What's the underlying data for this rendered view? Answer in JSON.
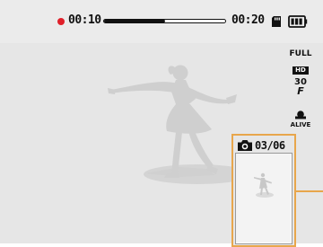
{
  "recording": {
    "current_time": "00:10",
    "total_time": "00:20",
    "progress_fraction": 0.5,
    "rec_indicator_color": "#e0202a"
  },
  "status_icons": [
    "memory-card-icon",
    "battery-icon"
  ],
  "side_icons": {
    "resolution": {
      "top": "FULL",
      "bottom": "HD"
    },
    "frame_rate": {
      "value": "30",
      "glyph": "F"
    },
    "mode": {
      "label": "ALIVE"
    }
  },
  "snapshot": {
    "count": "03/06",
    "icon": "camera-icon",
    "border_color": "#e8a64c"
  }
}
